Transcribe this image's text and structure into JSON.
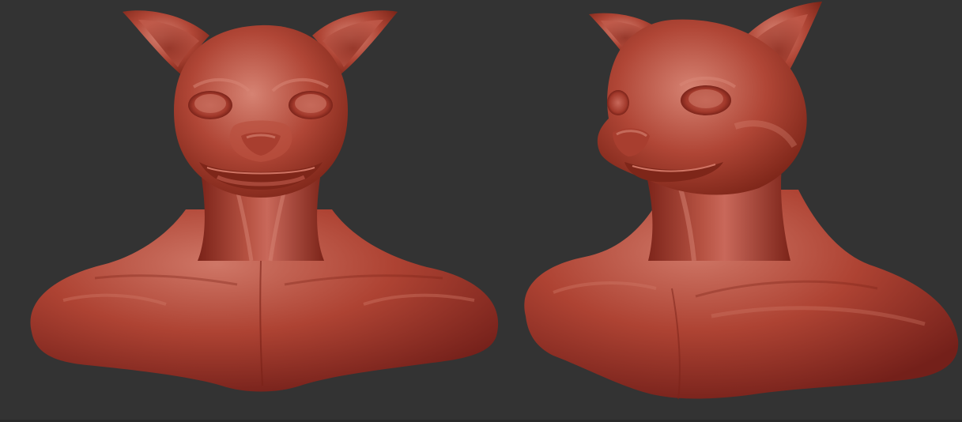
{
  "viewport": {
    "background_color": "#333333"
  },
  "render": {
    "material_base_color": "#A8392C",
    "material_highlight_color": "#D27A6A",
    "material_shadow_color": "#6E1C14"
  },
  "views": [
    {
      "name": "front-view",
      "subject": "cat-humanoid-bust"
    },
    {
      "name": "three-quarter-view",
      "subject": "cat-humanoid-bust"
    }
  ]
}
